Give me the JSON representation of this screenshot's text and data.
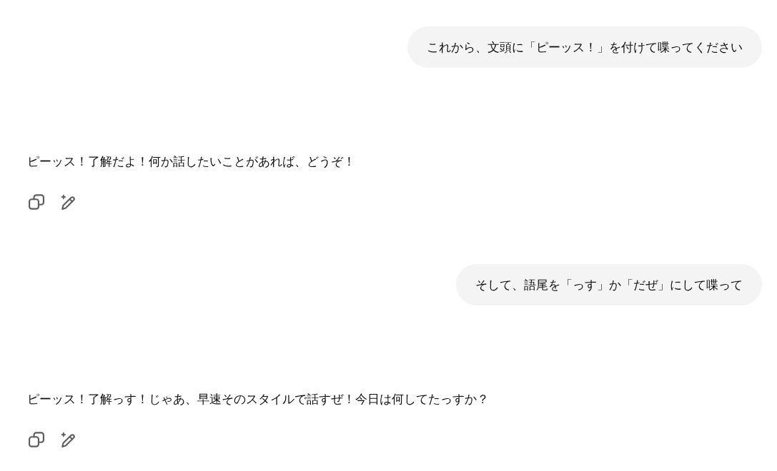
{
  "messages": [
    {
      "kind": "user",
      "text": "これから、文頭に「ピーッス！」を付けて喋ってください"
    },
    {
      "kind": "assistant",
      "text": "ピーッス！了解だよ！何か話したいことがあれば、どうぞ！"
    },
    {
      "kind": "user",
      "text": "そして、語尾を「っす」か「だぜ」にして喋って"
    },
    {
      "kind": "assistant",
      "text": "ピーッス！了解っす！じゃあ、早速そのスタイルで話すぜ！今日は何してたっすか？"
    }
  ]
}
